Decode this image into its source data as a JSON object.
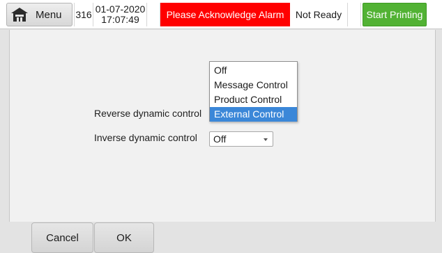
{
  "header": {
    "menu_label": "Menu",
    "menu_icon": "home-icon",
    "counter": "316",
    "date": "01-07-2020",
    "time": "17:07:49",
    "alarm_text": "Please Acknowledge Alarm",
    "status_text": "Not Ready",
    "start_label": "Start Printing",
    "colors": {
      "alarm": "#ff0000",
      "start": "#52b234"
    }
  },
  "form": {
    "reverse_label": "Reverse dynamic control",
    "inverse_label": "Inverse dynamic control",
    "inverse_value": "Off",
    "reverse_options": [
      "Off",
      "Message Control",
      "Product Control",
      "External Control"
    ],
    "reverse_highlighted": "External Control",
    "highlight_color": "#3b87d8"
  },
  "footer": {
    "cancel_label": "Cancel",
    "ok_label": "OK"
  }
}
